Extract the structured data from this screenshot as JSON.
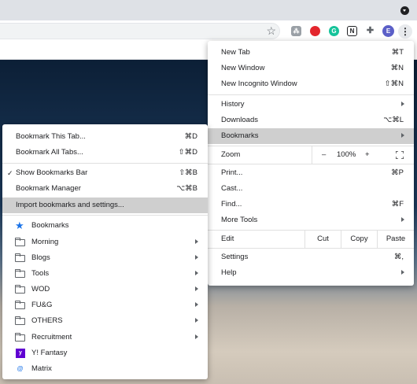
{
  "toolbar": {
    "star_icon": "star-icon",
    "extensions": [
      {
        "icon": "extension-gray-icon",
        "glyph": "⁂",
        "color": "#9aa0a6"
      },
      {
        "icon": "extension-red-icon",
        "glyph": "●",
        "color": "#e3262d"
      },
      {
        "icon": "grammarly-icon",
        "glyph": "G",
        "color": "#15c39a"
      },
      {
        "icon": "notion-icon",
        "glyph": "N",
        "color": "#202124"
      },
      {
        "icon": "puzzle-icon",
        "glyph": "✚",
        "color": "#5f6368"
      }
    ],
    "profile_initial": "E",
    "profile_color": "#5b5fc7"
  },
  "menu": {
    "new_tab": {
      "label": "New Tab",
      "shortcut": "⌘T"
    },
    "new_window": {
      "label": "New Window",
      "shortcut": "⌘N"
    },
    "new_incognito": {
      "label": "New Incognito Window",
      "shortcut": "⇧⌘N"
    },
    "history": {
      "label": "History"
    },
    "downloads": {
      "label": "Downloads",
      "shortcut": "⌥⌘L"
    },
    "bookmarks": {
      "label": "Bookmarks"
    },
    "zoom": {
      "label": "Zoom",
      "minus": "–",
      "level": "100%",
      "plus": "+"
    },
    "print": {
      "label": "Print...",
      "shortcut": "⌘P"
    },
    "cast": {
      "label": "Cast..."
    },
    "find": {
      "label": "Find...",
      "shortcut": "⌘F"
    },
    "more_tools": {
      "label": "More Tools"
    },
    "edit": {
      "label": "Edit",
      "cut": "Cut",
      "copy": "Copy",
      "paste": "Paste"
    },
    "settings": {
      "label": "Settings",
      "shortcut": "⌘,"
    },
    "help": {
      "label": "Help"
    }
  },
  "bookmarks_menu": {
    "bookmark_this_tab": {
      "label": "Bookmark This Tab...",
      "shortcut": "⌘D"
    },
    "bookmark_all_tabs": {
      "label": "Bookmark All Tabs...",
      "shortcut": "⇧⌘D"
    },
    "show_bookmarks_bar": {
      "label": "Show Bookmarks Bar",
      "shortcut": "⇧⌘B",
      "checked": "✓"
    },
    "bookmark_manager": {
      "label": "Bookmark Manager",
      "shortcut": "⌥⌘B"
    },
    "import": {
      "label": "Import bookmarks and settings..."
    },
    "bookmarks_label": "Bookmarks",
    "folders": [
      "Morning",
      "Blogs",
      "Tools",
      "WOD",
      "FU&G",
      "OTHERS",
      "Recruitment"
    ],
    "links": [
      {
        "label": "Y! Fantasy",
        "icon": "y"
      },
      {
        "label": "Matrix",
        "icon": "@"
      }
    ]
  }
}
